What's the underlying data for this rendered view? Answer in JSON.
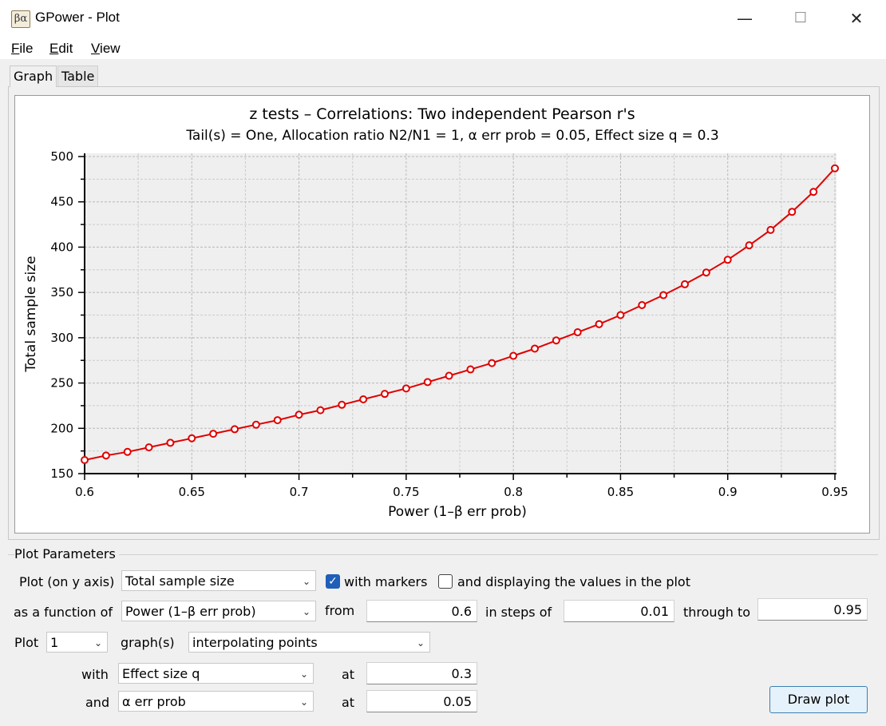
{
  "window": {
    "title": "GPower - Plot",
    "icon_text": "βα",
    "controls": {
      "minimize": "—",
      "maximize": "☐",
      "close": "✕"
    }
  },
  "menu": {
    "file": {
      "accel": "F",
      "rest": "ile"
    },
    "edit": {
      "accel": "E",
      "rest": "dit"
    },
    "view": {
      "accel": "V",
      "rest": "iew"
    }
  },
  "tabs": {
    "graph": "Graph",
    "table": "Table"
  },
  "chart_data": {
    "type": "line",
    "title": "z tests – Correlations: Two independent Pearson r's",
    "subtitle": "Tail(s) = One, Allocation ratio N2/N1 = 1, α err prob = 0.05, Effect size q = 0.3",
    "xlabel": "Power (1–β err prob)",
    "ylabel": "Total sample size",
    "xlim": [
      0.6,
      0.95
    ],
    "ylim": [
      150,
      500
    ],
    "xticks": [
      "0.6",
      "0.65",
      "0.7",
      "0.75",
      "0.8",
      "0.85",
      "0.9",
      "0.95"
    ],
    "yticks": [
      "150",
      "200",
      "250",
      "300",
      "350",
      "400",
      "450",
      "500"
    ],
    "grid": true,
    "markers": true,
    "line_color": "#e00000",
    "marker_fill": "#ffffff",
    "x": [
      0.6,
      0.61,
      0.62,
      0.63,
      0.64,
      0.65,
      0.66,
      0.67,
      0.68,
      0.69,
      0.7,
      0.71,
      0.72,
      0.73,
      0.74,
      0.75,
      0.76,
      0.77,
      0.78,
      0.79,
      0.8,
      0.81,
      0.82,
      0.83,
      0.84,
      0.85,
      0.86,
      0.87,
      0.88,
      0.89,
      0.9,
      0.91,
      0.92,
      0.93,
      0.94,
      0.95
    ],
    "values": [
      165,
      170,
      174,
      179,
      184,
      189,
      194,
      199,
      204,
      209,
      215,
      220,
      226,
      232,
      238,
      244,
      251,
      258,
      265,
      272,
      280,
      288,
      297,
      306,
      315,
      325,
      336,
      347,
      359,
      372,
      386,
      402,
      419,
      439,
      461,
      487
    ]
  },
  "params": {
    "group_title": "Plot Parameters",
    "y_axis_label": "Plot (on y axis)",
    "y_axis_value": "Total sample size",
    "with_markers": {
      "label": "with markers",
      "checked": true
    },
    "display_values": {
      "label": "and displaying the values in the plot",
      "checked": false
    },
    "function_label": "as a function of",
    "function_value": "Power (1–β err prob)",
    "from_label": "from",
    "from_value": "0.6",
    "steps_label": "in steps of",
    "steps_value": "0.01",
    "through_label": "through to",
    "through_value": "0.95",
    "plot_label": "Plot",
    "plot_count": "1",
    "graphs_label": "graph(s)",
    "graph_mode": "interpolating points",
    "with_label": "with",
    "with_value": "Effect size q",
    "at_label": "at",
    "with_at_value": "0.3",
    "and_label": "and",
    "and_value": "α err prob",
    "and_at_value": "0.05",
    "draw_button": "Draw plot"
  }
}
